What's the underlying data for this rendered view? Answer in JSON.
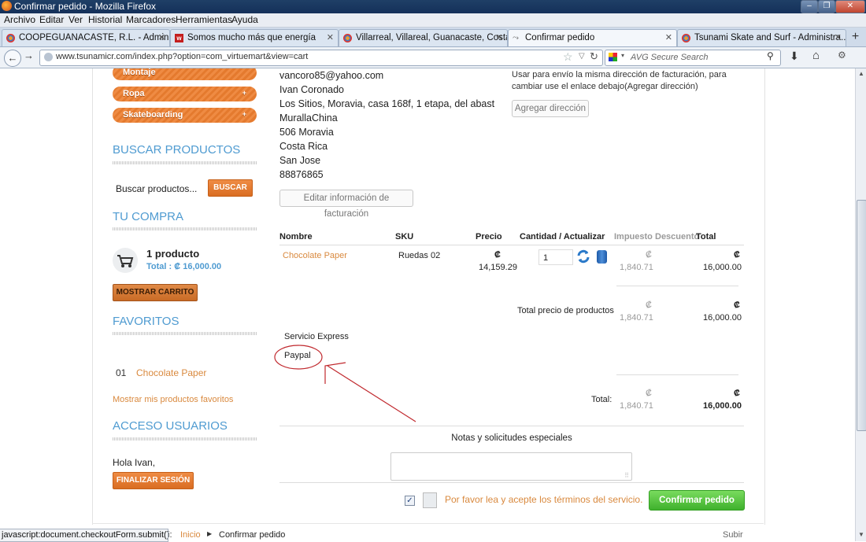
{
  "window": {
    "title": "Confirmar pedido - Mozilla Firefox"
  },
  "menu": [
    "Archivo",
    "Editar",
    "Ver",
    "Historial",
    "Marcadores",
    "Herramientas",
    "Ayuda"
  ],
  "tabs": [
    {
      "label": "COOPEGUANACASTE, R.L. - Adminis...",
      "icon": "joomla-icon"
    },
    {
      "label": "Somos mucho más que energía",
      "icon": "w-icon"
    },
    {
      "label": "Villarreal, Villareal, Guanacaste, Costa ...",
      "icon": "joomla-icon"
    },
    {
      "label": "Confirmar pedido",
      "icon": "page-icon"
    },
    {
      "label": "Tsunami Skate and Surf - Administra...",
      "icon": "joomla-icon"
    }
  ],
  "nav": {
    "url": "www.tsunamicr.com/index.php?option=com_virtuemart&view=cart",
    "search_placeholder": "AVG Secure Search"
  },
  "sidebar": {
    "categories": [
      {
        "label": "Montaje"
      },
      {
        "label": "Ropa",
        "arrow": "+"
      },
      {
        "label": "Skateboarding",
        "arrow": "+"
      }
    ],
    "search_heading": "BUSCAR PRODUCTOS",
    "search_placeholder": "Buscar productos...",
    "search_button": "BUSCAR",
    "cart_heading": "TU COMPRA",
    "cart_count": "1 producto",
    "cart_total": "Total : ₡ 16,000.00",
    "cart_button": "MOSTRAR CARRITO",
    "favorites_heading": "FAVORITOS",
    "favorite_num": "01",
    "favorite_item": "Chocolate Paper",
    "favorites_link": "Mostrar mis productos favoritos",
    "users_heading": "ACCESO USUARIOS",
    "greeting": "Hola Ivan,",
    "logout_button": "FINALIZAR SESIÓN"
  },
  "billing": {
    "lines": [
      "vancoro85@yahoo.com",
      "Ivan Coronado",
      "Los Sitios, Moravia, casa 168f, 1 etapa, del abast",
      "MurallaChina",
      "506 Moravia",
      "Costa Rica",
      "San Jose",
      "88876865"
    ],
    "edit_button": "Editar información de facturación"
  },
  "shipping": {
    "note": "Usar para envío la misma dirección de facturación, para cambiar use el enlace debajo(Agregar dirección)",
    "add_button": "Agregar dirección"
  },
  "cart": {
    "headers": {
      "name": "Nombre",
      "sku": "SKU",
      "price": "Precio",
      "qty": "Cantidad / Actualizar",
      "tax": "Impuesto",
      "discount": "Descuento",
      "total": "Total"
    },
    "row": {
      "name": "Chocolate Paper",
      "sku": "Ruedas 02",
      "currency": "₡",
      "price": "14,159.29",
      "qty": "1",
      "tax": "1,840.71",
      "total": "16,000.00"
    },
    "subtotal_label": "Total precio de productos",
    "subtotal_tax": "1,840.71",
    "subtotal_total": "16,000.00",
    "shipping_method": "Servicio Express",
    "payment_method": "Paypal",
    "grand_label": "Total:",
    "grand_tax": "1,840.71",
    "grand_total": "16,000.00"
  },
  "notes_label": "Notas y solicitudes especiales",
  "terms_text": "Por favor lea y acepte los términos del servicio.",
  "confirm_button": "Confirmar pedido",
  "status_url": "javascript:document.checkoutForm.submit();",
  "breadcrumb": {
    "prefix": "i:",
    "home": "Inicio",
    "current": "Confirmar pedido"
  },
  "back_to_top": "Subir",
  "colors": {
    "accent_orange": "#e47a2e",
    "heading_blue": "#4f9bd1",
    "confirm_green": "#4cc43a",
    "link_orange": "#d9893e"
  }
}
